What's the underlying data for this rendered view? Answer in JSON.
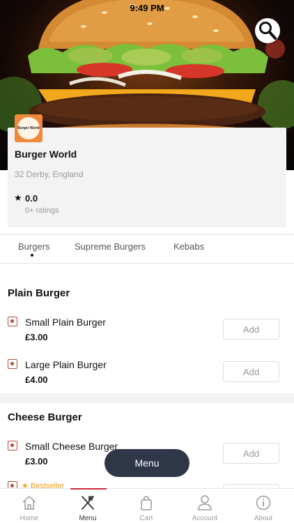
{
  "status_bar": {
    "time": "9:49 PM"
  },
  "hero": {
    "search_icon": "search-icon"
  },
  "restaurant": {
    "logo_text": "Burger World",
    "name": "Burger World",
    "address": "32 Derby, England",
    "rating_star": "★",
    "rating": "0.0",
    "rating_count": "0+ ratings"
  },
  "tabs": [
    {
      "label": "Burgers",
      "active": true
    },
    {
      "label": "Supreme Burgers",
      "active": false
    },
    {
      "label": "Kebabs",
      "active": false
    }
  ],
  "sections": [
    {
      "title": "Plain Burger",
      "items": [
        {
          "name": "Small Plain Burger",
          "price": "£3.00",
          "add_label": "Add"
        },
        {
          "name": "Large Plain Burger",
          "price": "£4.00",
          "add_label": "Add"
        }
      ]
    },
    {
      "title": "Cheese Burger",
      "items": [
        {
          "name": "Small Cheese Burger",
          "price": "£3.00",
          "add_label": "Add"
        },
        {
          "name": "",
          "price": "",
          "add_label": "Add",
          "badge": "★ Bestseller"
        }
      ]
    }
  ],
  "menu_button": {
    "label": "Menu"
  },
  "bottom_nav": [
    {
      "label": "Home",
      "icon": "home-icon",
      "active": false
    },
    {
      "label": "Menu",
      "icon": "fork-knife-icon",
      "active": true
    },
    {
      "label": "Cart",
      "icon": "bag-icon",
      "active": false
    },
    {
      "label": "Account",
      "icon": "person-icon",
      "active": false
    },
    {
      "label": "About",
      "icon": "info-icon",
      "active": false
    }
  ],
  "colors": {
    "accent": "#d0283c",
    "checkbox": "#b84a3c",
    "fab": "#2f3647",
    "bestseller": "#f0a020"
  }
}
